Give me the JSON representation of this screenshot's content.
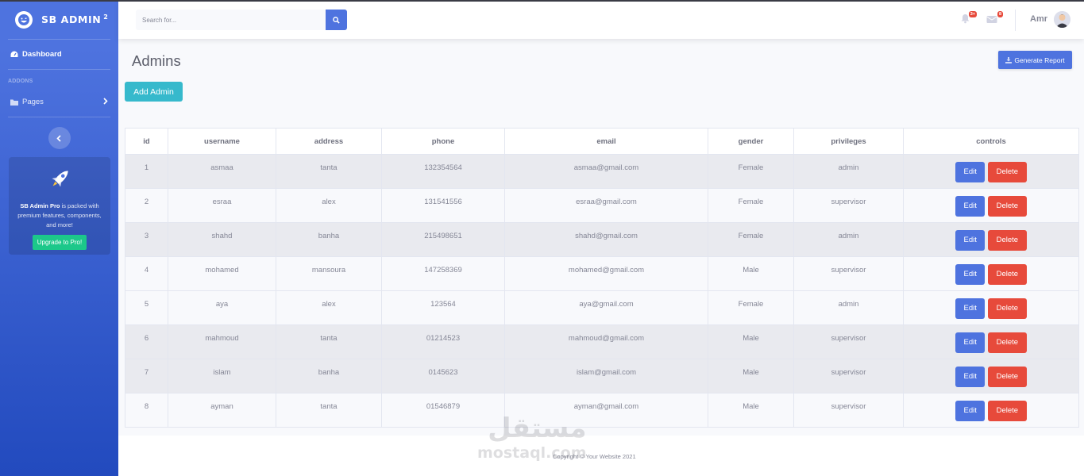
{
  "brand": {
    "name": "SB ADMIN",
    "sup": "2"
  },
  "sidebar": {
    "dashboard_label": "Dashboard",
    "heading": "ADDONS",
    "pages_label": "Pages",
    "promo": {
      "brand": "SB Admin Pro",
      "text": " is packed with premium features, components, and more!",
      "button": "Upgrade to Pro!"
    }
  },
  "topbar": {
    "search_placeholder": "Search for...",
    "alerts_badge": "3+",
    "messages_badge": "8",
    "user_name": "Amr"
  },
  "main": {
    "title": "Admins",
    "generate_report_label": "Generate Report",
    "add_admin_label": "Add Admin"
  },
  "table": {
    "headers": [
      "id",
      "username",
      "address",
      "phone",
      "email",
      "gender",
      "privileges",
      "controls"
    ],
    "edit_label": "Edit",
    "delete_label": "Delete",
    "rows": [
      [
        "1",
        "asmaa",
        "tanta",
        "132354564",
        "asmaa@gmail.com",
        "Female",
        "admin"
      ],
      [
        "2",
        "esraa",
        "alex",
        "131541556",
        "esraa@gmail.com",
        "Female",
        "supervisor"
      ],
      [
        "3",
        "shahd",
        "banha",
        "215498651",
        "shahd@gmail.com",
        "Female",
        "admin"
      ],
      [
        "4",
        "mohamed",
        "mansoura",
        "147258369",
        "mohamed@gmail.com",
        "Male",
        "supervisor"
      ],
      [
        "5",
        "aya",
        "alex",
        "123564",
        "aya@gmail.com",
        "Female",
        "admin"
      ],
      [
        "6",
        "mahmoud",
        "tanta",
        "01214523",
        "mahmoud@gmail.com",
        "Male",
        "supervisor"
      ],
      [
        "7",
        "islam",
        "banha",
        "0145623",
        "islam@gmail.com",
        "Male",
        "supervisor"
      ],
      [
        "8",
        "ayman",
        "tanta",
        "01546879",
        "ayman@gmail.com",
        "Male",
        "supervisor"
      ]
    ]
  },
  "footer": {
    "copyright": "Copyright © Your Website 2021"
  },
  "watermark": {
    "arabic": "مستقل",
    "latin": "mostaql.com"
  },
  "colors": {
    "primary": "#4e73df",
    "info": "#36b9cc",
    "danger": "#e74a3b",
    "success": "#1cc88a"
  }
}
